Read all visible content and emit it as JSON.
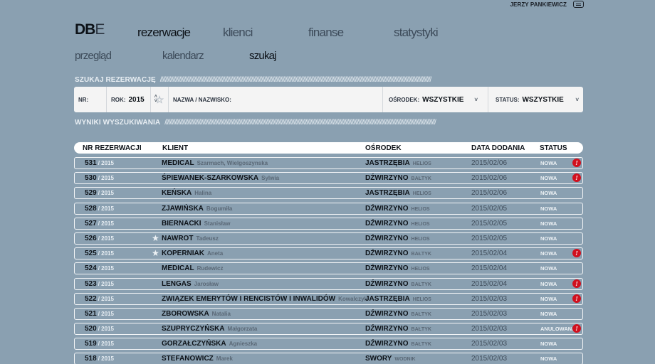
{
  "user": {
    "name": "JERZY PANKIEWICZ",
    "mail_icon": "mail-icon"
  },
  "logo": {
    "bold": "DB",
    "light": "E"
  },
  "main_nav": [
    {
      "label": "rezerwacje",
      "active": true
    },
    {
      "label": "klienci",
      "active": false
    },
    {
      "label": "finanse",
      "active": false
    },
    {
      "label": "statystyki",
      "active": false
    }
  ],
  "sub_nav": [
    {
      "label": "przegląd",
      "active": false
    },
    {
      "label": "kalendarz",
      "active": false
    },
    {
      "label": "szukaj",
      "active": true
    }
  ],
  "search": {
    "title": "SZUKAJ REZERWACJĘ",
    "nr_label": "NR:",
    "rok_label": "ROK:",
    "rok_value": "2015",
    "name_label": "NAZWA / NAZWISKO:",
    "osrodek_label": "OŚRODEK:",
    "osrodek_value": "WSZYSTKIE",
    "status_label": "STATUS:",
    "status_value": "WSZYSTKIE"
  },
  "results": {
    "title": "WYNIKI WYSZUKIWANIA",
    "columns": {
      "nr": "NR REZERWACJI",
      "client": "KLIENT",
      "osrodek": "OŚRODEK",
      "date": "DATA DODANIA",
      "status": "STATUS"
    },
    "rows": [
      {
        "nr": "531",
        "year": "/ 2015",
        "client": "MEDICAL",
        "first": "Szarmach, Wielgoszynska",
        "osrodek": "JASTRZĘBIA",
        "sub": "HELIOS",
        "date": "2015/02/06",
        "status": "NOWA",
        "star": false,
        "alert": true
      },
      {
        "nr": "530",
        "year": "/ 2015",
        "client": "ŚPIEWANEK-SZARKOWSKA",
        "first": "Sylwia",
        "osrodek": "DŹWIRZYNO",
        "sub": "BAŁTYK",
        "date": "2015/02/06",
        "status": "NOWA",
        "star": false,
        "alert": true
      },
      {
        "nr": "529",
        "year": "/ 2015",
        "client": "KEŃSKA",
        "first": "Halina",
        "osrodek": "JASTRZĘBIA",
        "sub": "HELIOS",
        "date": "2015/02/06",
        "status": "NOWA",
        "star": false,
        "alert": false
      },
      {
        "nr": "528",
        "year": "/ 2015",
        "client": "ZJAWIŃSKA",
        "first": "Bogumiła",
        "osrodek": "DŹWIRZYNO",
        "sub": "HELIOS",
        "date": "2015/02/05",
        "status": "NOWA",
        "star": false,
        "alert": false
      },
      {
        "nr": "527",
        "year": "/ 2015",
        "client": "BIERNACKI",
        "first": "Stanisław",
        "osrodek": "DŹWIRZYNO",
        "sub": "HELIOS",
        "date": "2015/02/05",
        "status": "NOWA",
        "star": false,
        "alert": false
      },
      {
        "nr": "526",
        "year": "/ 2015",
        "client": "NAWROT",
        "first": "Tadeusz",
        "osrodek": "DŹWIRZYNO",
        "sub": "HELIOS",
        "date": "2015/02/05",
        "status": "NOWA",
        "star": true,
        "alert": false
      },
      {
        "nr": "525",
        "year": "/ 2015",
        "client": "KOPERNIAK",
        "first": "Aneta",
        "osrodek": "DŹWIRZYNO",
        "sub": "BAŁTYK",
        "date": "2015/02/04",
        "status": "NOWA",
        "star": true,
        "alert": true
      },
      {
        "nr": "524",
        "year": "/ 2015",
        "client": "MEDICAL",
        "first": "Rudewicz",
        "osrodek": "DŹWIRZYNO",
        "sub": "HELIOS",
        "date": "2015/02/04",
        "status": "NOWA",
        "star": false,
        "alert": false
      },
      {
        "nr": "523",
        "year": "/ 2015",
        "client": "LENGAS",
        "first": "Jarosław",
        "osrodek": "DŹWIRZYNO",
        "sub": "BAŁTYK",
        "date": "2015/02/04",
        "status": "NOWA",
        "star": false,
        "alert": true
      },
      {
        "nr": "522",
        "year": "/ 2015",
        "client": "ZWIĄZEK EMERYTÓW I RENCISTÓW I INWALIDÓW",
        "first": "Kowalczyk",
        "osrodek": "JASTRZĘBIA",
        "sub": "HELIOS",
        "date": "2015/02/03",
        "status": "NOWA",
        "star": false,
        "alert": true
      },
      {
        "nr": "521",
        "year": "/ 2015",
        "client": "ZBOROWSKA",
        "first": "Natalia",
        "osrodek": "DŹWIRZYNO",
        "sub": "BAŁTYK",
        "date": "2015/02/03",
        "status": "NOWA",
        "star": false,
        "alert": false
      },
      {
        "nr": "520",
        "year": "/ 2015",
        "client": "SZUPRYCZYŃSKA",
        "first": "Małgorzata",
        "osrodek": "DŹWIRZYNO",
        "sub": "BAŁTYK",
        "date": "2015/02/03",
        "status": "ANULOWANA",
        "star": false,
        "alert": true
      },
      {
        "nr": "519",
        "year": "/ 2015",
        "client": "GORZAŁCZYŃSKA",
        "first": "Agnieszka",
        "osrodek": "DŹWIRZYNO",
        "sub": "BAŁTYK",
        "date": "2015/02/03",
        "status": "NOWA",
        "star": false,
        "alert": false
      },
      {
        "nr": "518",
        "year": "/ 2015",
        "client": "STEFANOWICZ",
        "first": "Marek",
        "osrodek": "SWORY",
        "sub": "WODNIK",
        "date": "2015/02/03",
        "status": "NOWA",
        "star": false,
        "alert": false
      }
    ]
  },
  "colors": {
    "background": "#8aa0b1",
    "alert": "#d0101e",
    "panel": "#f4f4f4"
  }
}
